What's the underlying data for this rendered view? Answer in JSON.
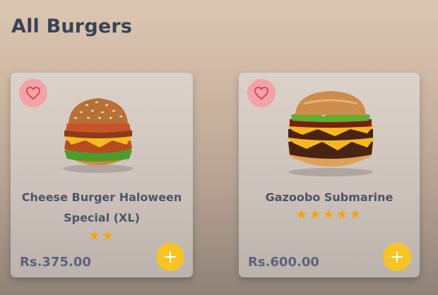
{
  "page": {
    "title": "All Burgers"
  },
  "products": [
    {
      "name": "Cheese Burger Haloween Special (XL)",
      "rating": 2,
      "stars_text": "★★",
      "price": "Rs.375.00",
      "favorite_icon": "heart-outline-icon",
      "add_icon": "plus-icon",
      "image": "cheese-burger-image"
    },
    {
      "name": "Gazoobo Submarine",
      "rating": 5,
      "stars_text": "★★★★★",
      "price": "Rs.600.00",
      "favorite_icon": "heart-outline-icon",
      "add_icon": "plus-icon",
      "image": "gazoobo-burger-image"
    }
  ],
  "colors": {
    "title": "#3a4256",
    "favorite_bg": "#f3a2a8",
    "favorite_icon": "#d24a5c",
    "star": "#f5a312",
    "add_bg": "#f7c325"
  }
}
